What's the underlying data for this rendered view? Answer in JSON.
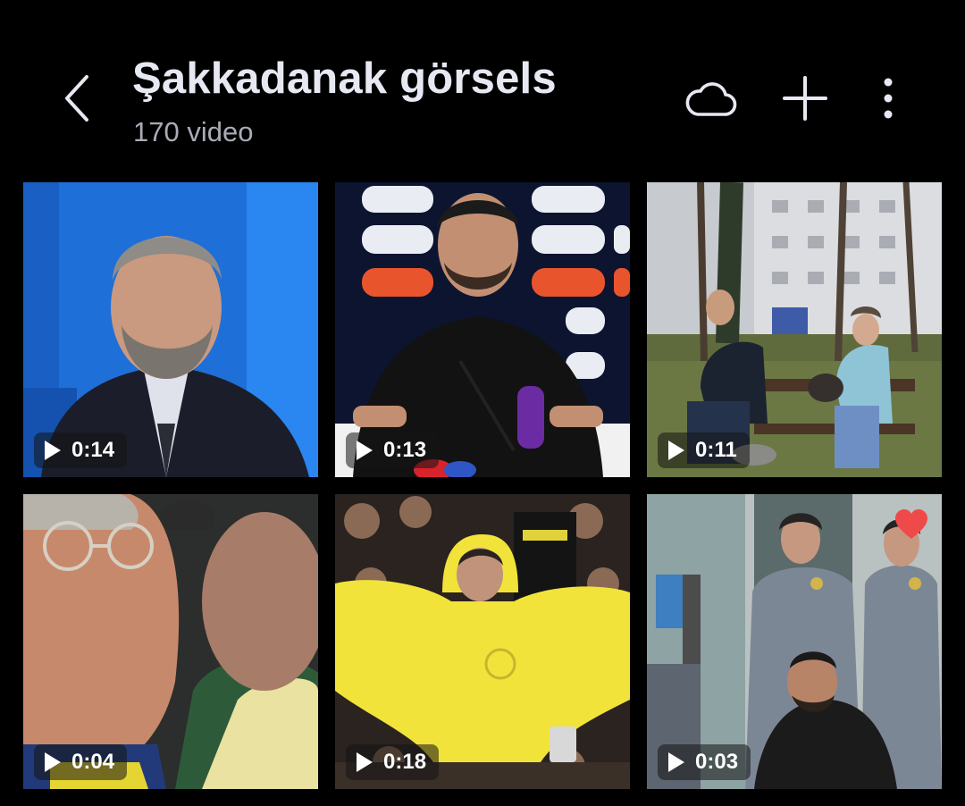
{
  "album": {
    "title": "Şakkadanak görsels",
    "count_label": "170 video"
  },
  "toolbar": {
    "back_icon": "chevron-left-icon",
    "cloud_icon": "cloud-icon",
    "add_icon": "plus-icon",
    "more_icon": "more-vertical-icon"
  },
  "colors": {
    "background": "#000000",
    "title": "#e6e8f2",
    "subtitle": "#a9acb6",
    "favorite": "#ef4a4a"
  },
  "videos": [
    {
      "duration": "0:14",
      "favorite": false
    },
    {
      "duration": "0:13",
      "favorite": false
    },
    {
      "duration": "0:11",
      "favorite": false
    },
    {
      "duration": "0:04",
      "favorite": false
    },
    {
      "duration": "0:18",
      "favorite": false
    },
    {
      "duration": "0:03",
      "favorite": true
    }
  ]
}
